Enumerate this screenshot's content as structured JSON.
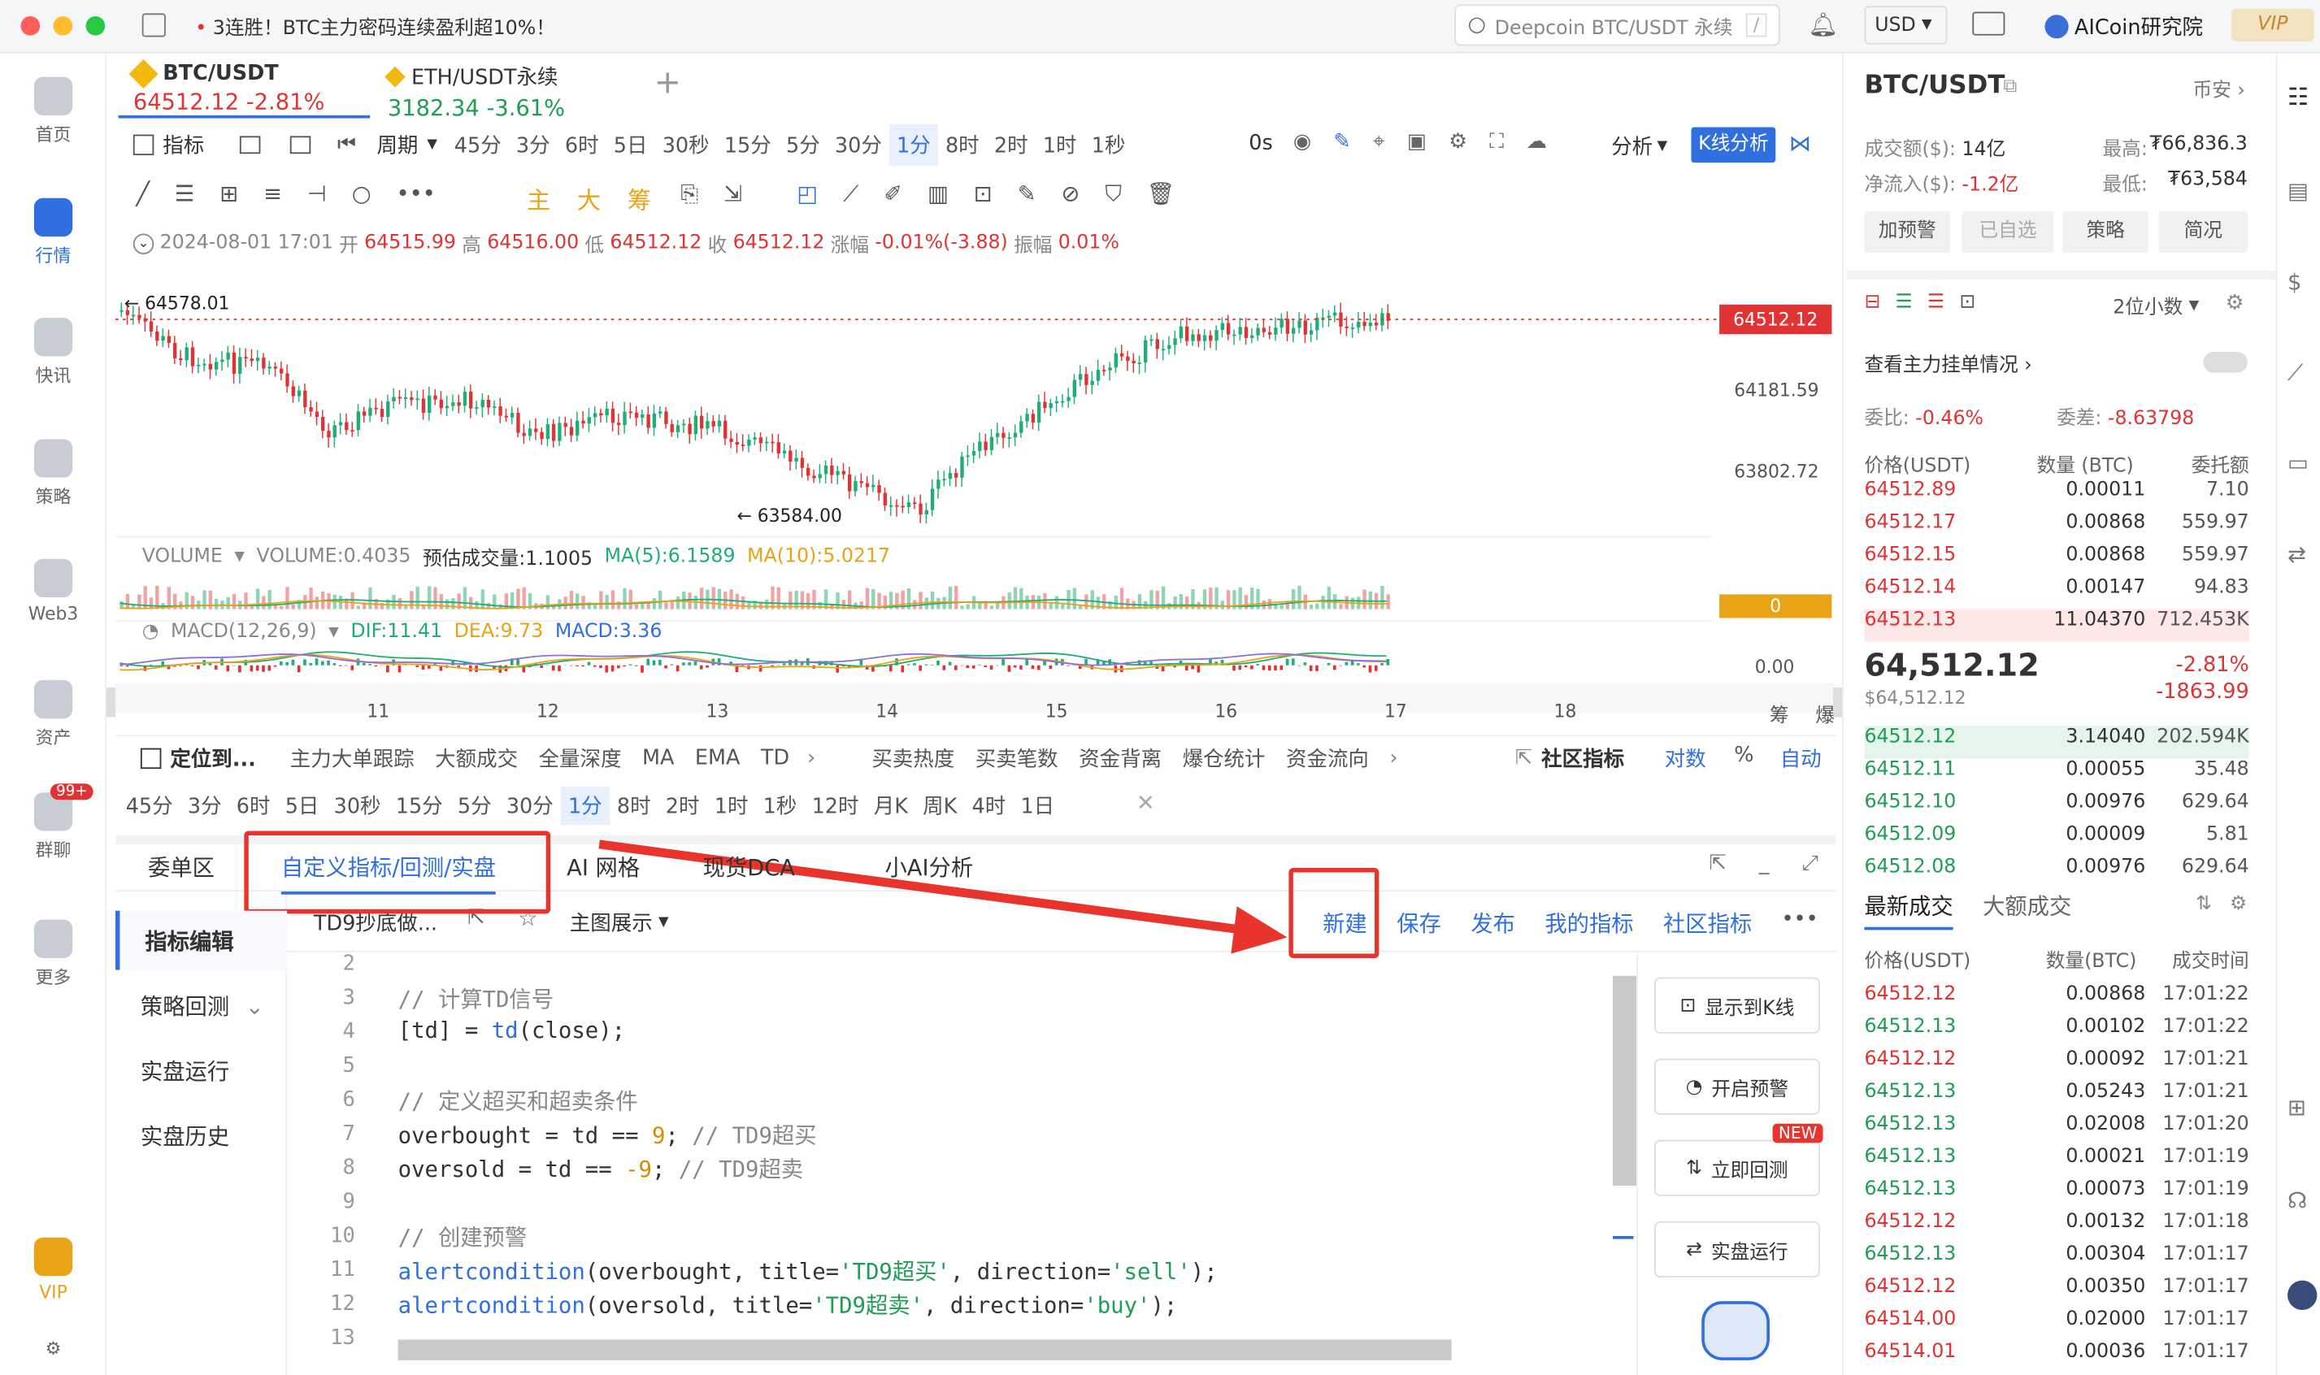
{
  "titlebar": {
    "notice": "3连胜！BTC主力密码连续盈利超10%！",
    "search_placeholder": "Deepcoin BTC/USDT 永续",
    "search_shortcut": "/",
    "currency": "USD",
    "brand": "AICoin研究院",
    "vip": "VIP"
  },
  "sidebar": [
    {
      "label": "首页",
      "icon": "home-icon"
    },
    {
      "label": "行情",
      "icon": "market-icon"
    },
    {
      "label": "快讯",
      "icon": "news-icon"
    },
    {
      "label": "策略",
      "icon": "robot-icon"
    },
    {
      "label": "Web3",
      "icon": "web3-icon"
    },
    {
      "label": "资产",
      "icon": "wallet-icon"
    },
    {
      "label": "群聊",
      "icon": "chat-icon",
      "badge": "99+"
    },
    {
      "label": "更多",
      "icon": "grid-icon"
    },
    {
      "label": "VIP",
      "icon": "vip-icon"
    }
  ],
  "symbol_tabs": [
    {
      "name": "BTC/USDT",
      "price": "64512.12",
      "change": "-2.81%"
    },
    {
      "name": "ETH/USDT永续",
      "price": "3182.34",
      "change": "-3.61%"
    }
  ],
  "toolbar": {
    "indicator": "指标",
    "period": "周期",
    "periods": [
      "45分",
      "3分",
      "6时",
      "5日",
      "30秒",
      "15分",
      "5分",
      "30分",
      "1分",
      "8时",
      "2时",
      "1时",
      "1秒"
    ],
    "active_period": "1分",
    "timer": "0s",
    "analysis": "分析",
    "kline_analysis": "K线分析",
    "draw_text": [
      "主",
      "大",
      "筹"
    ]
  },
  "ohlc": {
    "datetime": "2024-08-01 17:01",
    "open_label": "开",
    "open": "64515.99",
    "high_label": "高",
    "high": "64516.00",
    "low_label": "低",
    "low": "64512.12",
    "close_label": "收",
    "close": "64512.12",
    "change_label": "涨幅",
    "change": "-0.01%(-3.88)",
    "amp_label": "振幅",
    "amp": "0.01%"
  },
  "chart": {
    "high_marker": "← 64578.01",
    "low_marker": "← 63584.00",
    "last_price": "64512.12",
    "y_ticks": [
      "64181.59",
      "63802.72"
    ],
    "x_ticks": [
      "11",
      "12",
      "13",
      "14",
      "15",
      "16",
      "17",
      "18"
    ],
    "volume_label": "VOLUME",
    "volume_value": "VOLUME:0.4035",
    "volume_est": "预估成交量:1.1005",
    "ma5": "MA(5):6.1589",
    "ma10": "MA(10):5.0217",
    "volume_axis": "0",
    "macd_label": "MACD(12,26,9)",
    "dif": "DIF:11.41",
    "dea": "DEA:9.73",
    "macd": "MACD:3.36",
    "macd_axis": "0.00",
    "corner": [
      "筹",
      "爆"
    ]
  },
  "indicator_bar": {
    "locate": "定位到...",
    "items": [
      "主力大单跟踪",
      "大额成交",
      "全量深度",
      "MA",
      "EMA",
      "TD",
      "买卖热度",
      "买卖笔数",
      "资金背离",
      "爆仓统计",
      "资金流向"
    ],
    "community": "社区指标",
    "log": "对数",
    "pct": "%",
    "auto": "自动"
  },
  "period_bar": [
    "45分",
    "3分",
    "6时",
    "5日",
    "30秒",
    "15分",
    "5分",
    "30分",
    "1分",
    "8时",
    "2时",
    "1时",
    "1秒",
    "12时",
    "月K",
    "周K",
    "4时",
    "1日"
  ],
  "bottom_tabs": [
    "委单区",
    "自定义指标/回测/实盘",
    "AI 网格",
    "现货DCA",
    "小AI分析"
  ],
  "editor": {
    "left_nav": [
      "指标编辑",
      "策略回测",
      "实盘运行",
      "实盘历史"
    ],
    "script_name": "TD9抄底做...",
    "main_display": "主图展示",
    "actions": [
      "新建",
      "保存",
      "发布",
      "我的指标",
      "社区指标"
    ],
    "more": "•••",
    "side_buttons": [
      "显示到K线",
      "开启预警",
      "立即回测",
      "实盘运行"
    ],
    "new_badge": "NEW",
    "lines": [
      {
        "n": "2",
        "code": ""
      },
      {
        "n": "3",
        "code": "// 计算TD信号"
      },
      {
        "n": "4",
        "code": "[td] = td(close);"
      },
      {
        "n": "5",
        "code": ""
      },
      {
        "n": "6",
        "code": "// 定义超买和超卖条件"
      },
      {
        "n": "7",
        "code": "overbought = td == 9; // TD9超买"
      },
      {
        "n": "8",
        "code": "oversold = td == -9; // TD9超卖"
      },
      {
        "n": "9",
        "code": ""
      },
      {
        "n": "10",
        "code": "// 创建预警"
      },
      {
        "n": "11",
        "code": "alertcondition(overbought, title='TD9超买', direction='sell');"
      },
      {
        "n": "12",
        "code": "alertcondition(oversold, title='TD9超卖', direction='buy');"
      },
      {
        "n": "13",
        "code": ""
      }
    ]
  },
  "right_panel": {
    "symbol": "BTC/USDT",
    "exchange": "币安",
    "turnover_label": "成交额($):",
    "turnover": "14亿",
    "netflow_label": "净流入($):",
    "netflow": "-1.2亿",
    "high_label": "最高:",
    "high": "₮66,836.3",
    "low_label": "最低:",
    "low": "₮63,584",
    "buttons": [
      "加预警",
      "已自选",
      "策略",
      "简况"
    ],
    "decimals": "2位小数",
    "main_orders": "查看主力挂单情况",
    "ratio_label": "委比:",
    "ratio": "-0.46%",
    "diff_label": "委差:",
    "diff": "-8.63798",
    "ob_headers": [
      "价格(USDT)",
      "数量 (BTC)",
      "委托额"
    ],
    "asks": [
      [
        "64512.89",
        "0.00011",
        "7.10"
      ],
      [
        "64512.17",
        "0.00868",
        "559.97"
      ],
      [
        "64512.15",
        "0.00868",
        "559.97"
      ],
      [
        "64512.14",
        "0.00147",
        "94.83"
      ],
      [
        "64512.13",
        "11.04370",
        "712.453K"
      ]
    ],
    "last": "64,512.12",
    "last_usd": "$64,512.12",
    "last_pct": "-2.81%",
    "last_chg": "-1863.99",
    "bids": [
      [
        "64512.12",
        "3.14040",
        "202.594K"
      ],
      [
        "64512.11",
        "0.00055",
        "35.48"
      ],
      [
        "64512.10",
        "0.00976",
        "629.64"
      ],
      [
        "64512.09",
        "0.00009",
        "5.81"
      ],
      [
        "64512.08",
        "0.00976",
        "629.64"
      ]
    ],
    "trade_tabs": [
      "最新成交",
      "大额成交"
    ],
    "trade_headers": [
      "价格(USDT)",
      "数量(BTC)",
      "成交时间"
    ],
    "trades": [
      {
        "p": "64512.12",
        "q": "0.00868",
        "t": "17:01:22",
        "side": "sell"
      },
      {
        "p": "64512.13",
        "q": "0.00102",
        "t": "17:01:22",
        "side": "buy"
      },
      {
        "p": "64512.12",
        "q": "0.00092",
        "t": "17:01:21",
        "side": "sell"
      },
      {
        "p": "64512.13",
        "q": "0.05243",
        "t": "17:01:21",
        "side": "buy"
      },
      {
        "p": "64512.13",
        "q": "0.02008",
        "t": "17:01:20",
        "side": "buy"
      },
      {
        "p": "64512.13",
        "q": "0.00021",
        "t": "17:01:19",
        "side": "buy"
      },
      {
        "p": "64512.13",
        "q": "0.00073",
        "t": "17:01:19",
        "side": "buy"
      },
      {
        "p": "64512.12",
        "q": "0.00132",
        "t": "17:01:18",
        "side": "sell"
      },
      {
        "p": "64512.13",
        "q": "0.00304",
        "t": "17:01:17",
        "side": "buy"
      },
      {
        "p": "64512.12",
        "q": "0.00350",
        "t": "17:01:17",
        "side": "sell"
      },
      {
        "p": "64514.00",
        "q": "0.02000",
        "t": "17:01:17",
        "side": "sell"
      },
      {
        "p": "64514.01",
        "q": "0.00036",
        "t": "17:01:17",
        "side": "sell"
      }
    ]
  },
  "colors": {
    "up": "#1f9d55",
    "down": "#e03434",
    "accent": "#2f6fe0",
    "annotation": "#e8342c"
  }
}
